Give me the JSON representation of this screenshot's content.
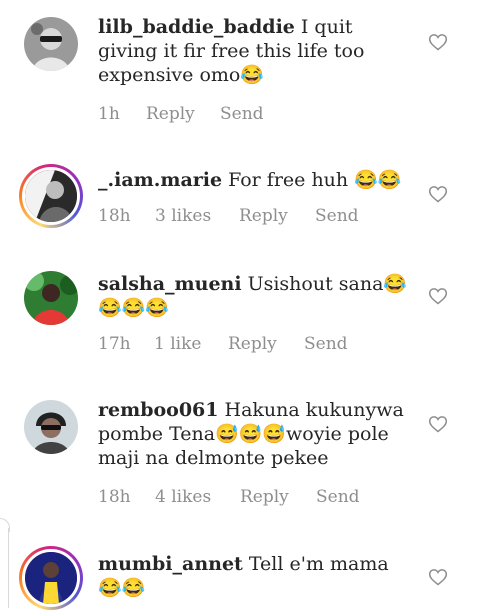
{
  "comments": [
    {
      "username": "lilb_baddie_baddie",
      "text": "I quit giving it fir free this life too expensive omo😂",
      "time": "1h",
      "likes": "",
      "reply_label": "Reply",
      "send_label": "Send"
    },
    {
      "username": "_.iam.marie",
      "text": "For free huh 😂😂",
      "time": "18h",
      "likes": "3 likes",
      "reply_label": "Reply",
      "send_label": "Send"
    },
    {
      "username": "salsha_mueni",
      "text": "Usishout sana😂😂😂😂",
      "time": "17h",
      "likes": "1 like",
      "reply_label": "Reply",
      "send_label": "Send"
    },
    {
      "username": "remboo061",
      "text": "Hakuna kukunywa pombe Tena😅😅😅woyie pole maji na delmonte pekee",
      "time": "18h",
      "likes": "4 likes",
      "reply_label": "Reply",
      "send_label": "Send"
    },
    {
      "username": "mumbi_annet",
      "text": "Tell e'm mama 😂😂",
      "time": "",
      "likes": "",
      "reply_label": "",
      "send_label": ""
    }
  ],
  "icons": {
    "like": "heart-outline-icon"
  },
  "colors": {
    "username": "#262626",
    "meta": "#8e8e8e",
    "story_ring": "#d62976"
  }
}
